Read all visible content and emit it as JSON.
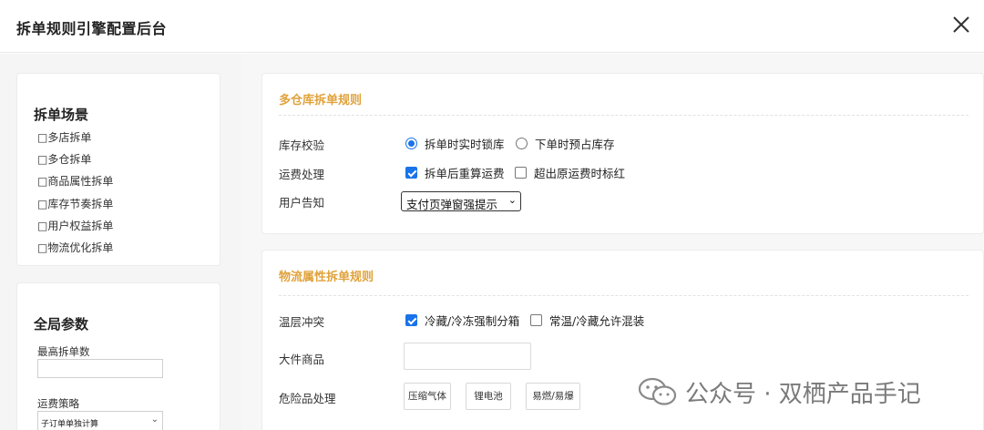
{
  "window": {
    "title": "拆单规则引擎配置后台"
  },
  "scenes": {
    "title": "拆单场景",
    "items": [
      "□多店拆单",
      "□多仓拆单",
      "□商品属性拆单",
      "□库存节奏拆单",
      "□用户权益拆单",
      "□物流优化拆单"
    ]
  },
  "global": {
    "title": "全局参数",
    "max_split_label": "最高拆单数",
    "max_split_value": "",
    "freight_label": "运费策略",
    "freight_value": "子订单单独计算"
  },
  "warehouse_rules": {
    "title": "多仓库拆单规则",
    "stock_check": {
      "label": "库存校验",
      "options": [
        "拆单时实时锁库",
        "下单时预占库存"
      ],
      "selected": 0
    },
    "freight": {
      "label": "运费处理",
      "options": [
        "拆单后重算运费",
        "超出原运费时标红"
      ],
      "checked": [
        true,
        false
      ]
    },
    "notify": {
      "label": "用户告知",
      "value": "支付页弹窗强提示"
    }
  },
  "logistics_rules": {
    "title": "物流属性拆单规则",
    "temperature": {
      "label": "温层冲突",
      "options": [
        "冷藏/冷冻强制分箱",
        "常温/冷藏允许混装"
      ],
      "checked": [
        true,
        false
      ]
    },
    "bulky": {
      "label": "大件商品",
      "value": ""
    },
    "hazard": {
      "label": "危险品处理",
      "tags": [
        "压缩气体",
        "锂电池",
        "易燃/易爆"
      ]
    }
  },
  "watermark": {
    "text": "公众号 · 双栖产品手记"
  },
  "icons": {
    "close": "close-icon",
    "chevron": "chevron-down-icon",
    "logo": "wechat-logo-icon"
  }
}
